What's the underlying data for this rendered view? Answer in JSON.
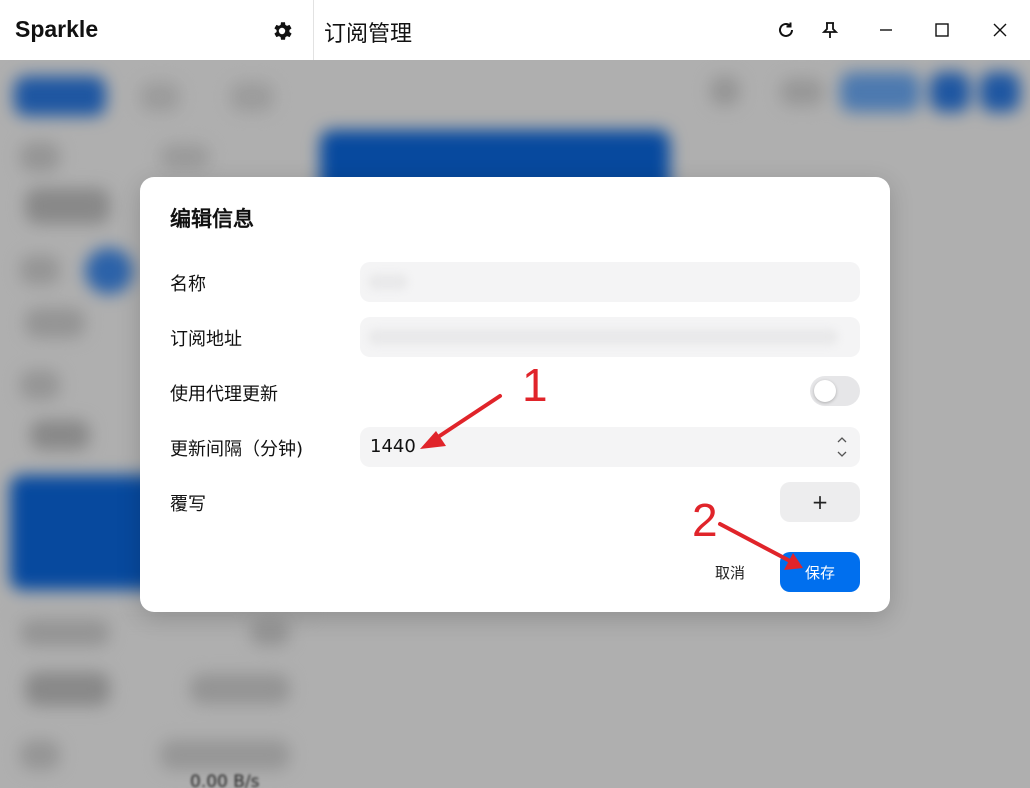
{
  "window": {
    "app_name": "Sparkle",
    "page_title": "订阅管理"
  },
  "background": {
    "blurred_texts": [
      "0.00 B/s"
    ]
  },
  "dialog": {
    "title": "编辑信息",
    "fields": {
      "name_label": "名称",
      "url_label": "订阅地址",
      "proxy_update_label": "使用代理更新",
      "proxy_update_enabled": false,
      "interval_label": "更新间隔（分钟)",
      "interval_value": "1440",
      "override_label": "覆写",
      "add_label": "+"
    },
    "buttons": {
      "cancel": "取消",
      "save": "保存"
    }
  },
  "annotations": {
    "marker_1": "1",
    "marker_2": "2",
    "color": "#e0242a"
  },
  "colors": {
    "accent": "#006fee",
    "background": "#f3f3f3"
  }
}
